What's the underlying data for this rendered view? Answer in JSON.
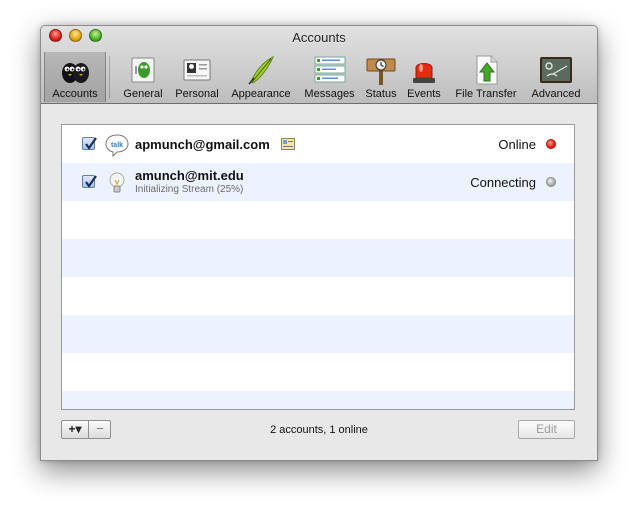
{
  "window": {
    "title": "Accounts"
  },
  "toolbar": {
    "items": [
      {
        "label": "Accounts",
        "icon": "accounts-icon",
        "active": true
      },
      {
        "label": "General",
        "icon": "general-icon"
      },
      {
        "label": "Personal",
        "icon": "personal-icon"
      },
      {
        "label": "Appearance",
        "icon": "appearance-icon"
      },
      {
        "label": "Messages",
        "icon": "messages-icon"
      },
      {
        "label": "Status",
        "icon": "status-icon"
      },
      {
        "label": "Events",
        "icon": "events-icon"
      },
      {
        "label": "File Transfer",
        "icon": "file-transfer-icon"
      },
      {
        "label": "Advanced",
        "icon": "advanced-icon"
      }
    ]
  },
  "accounts": [
    {
      "name": "apmunch@gmail.com",
      "status": "Online",
      "status_color": "#e01b10",
      "icon": "gtalk-icon",
      "enabled": true
    },
    {
      "name": "amunch@mit.edu",
      "sub": "Initializing Stream (25%)",
      "status": "Connecting",
      "status_color": "#a6a6a6",
      "icon": "jabber-bulb-icon",
      "enabled": true,
      "progress_percent": 25
    }
  ],
  "footer": {
    "add_label": "+▾",
    "remove_label": "−",
    "summary": "2 accounts, 1 online",
    "edit_label": "Edit"
  },
  "colors": {
    "row_alt": "#edf3fe",
    "online": "#e01b10"
  }
}
